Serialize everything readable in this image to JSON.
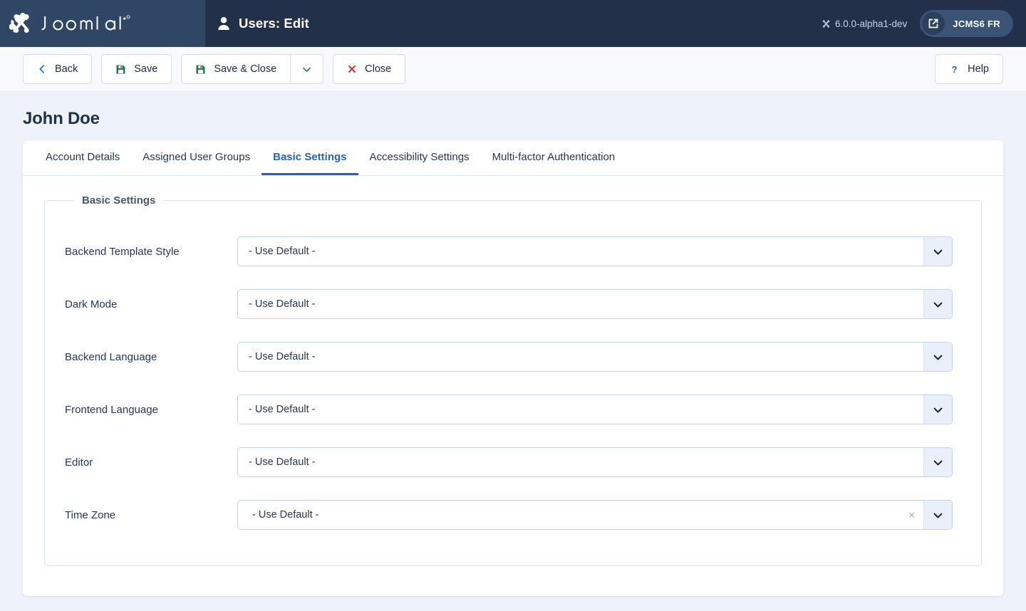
{
  "header": {
    "brand": "Joomla!",
    "brand_icon": "joomla-logo-icon",
    "title_icon": "user-icon",
    "title": "Users: Edit",
    "version_icon": "joomla-mark-icon",
    "version": "6.0.0-alpha1-dev",
    "site_button": {
      "icon": "external-link-icon",
      "label": "JCMS6 FR"
    },
    "colors": {
      "logo_bg": "#2f4764",
      "bar_bg": "#22304a",
      "site_btn_bg": "#3b5475"
    }
  },
  "toolbar": {
    "buttons": [
      {
        "name": "back",
        "label": "Back",
        "icon": "chevron-left-icon",
        "icon_color": "#1a6ec0"
      },
      {
        "name": "save",
        "label": "Save",
        "icon": "save-floppy-icon",
        "icon_color": "#1f7a45"
      },
      {
        "name": "save-close",
        "label": "Save & Close",
        "icon": "save-floppy-icon",
        "icon_color": "#1f7a45"
      },
      {
        "name": "save-close-dropdown",
        "label": "",
        "icon": "chevron-down-icon",
        "icon_color": "#2a8a4f"
      },
      {
        "name": "close",
        "label": "Close",
        "icon": "close-x-icon",
        "icon_color": "#cc2c2c"
      }
    ],
    "help": {
      "label": "Help",
      "icon": "question-mark-icon",
      "icon_color": "#2a62b0"
    }
  },
  "page": {
    "title": "John Doe"
  },
  "tabs": [
    {
      "label": "Account Details",
      "active": false
    },
    {
      "label": "Assigned User Groups",
      "active": false
    },
    {
      "label": "Basic Settings",
      "active": true
    },
    {
      "label": "Accessibility Settings",
      "active": false
    },
    {
      "label": "Multi-factor Authentication",
      "active": false
    }
  ],
  "fieldset": {
    "legend": "Basic Settings",
    "fields": [
      {
        "name": "backend-template-style",
        "label": "Backend Template Style",
        "value": "- Use Default -",
        "type": "select",
        "clearable": false
      },
      {
        "name": "dark-mode",
        "label": "Dark Mode",
        "value": "- Use Default -",
        "type": "select",
        "clearable": false
      },
      {
        "name": "backend-language",
        "label": "Backend Language",
        "value": "- Use Default -",
        "type": "select",
        "clearable": false
      },
      {
        "name": "frontend-language",
        "label": "Frontend Language",
        "value": "- Use Default -",
        "type": "select",
        "clearable": false
      },
      {
        "name": "editor",
        "label": "Editor",
        "value": "- Use Default -",
        "type": "select",
        "clearable": false
      },
      {
        "name": "time-zone",
        "label": "Time Zone",
        "value": "- Use Default -",
        "type": "choices",
        "clearable": true,
        "clear_label": "×"
      }
    ]
  }
}
